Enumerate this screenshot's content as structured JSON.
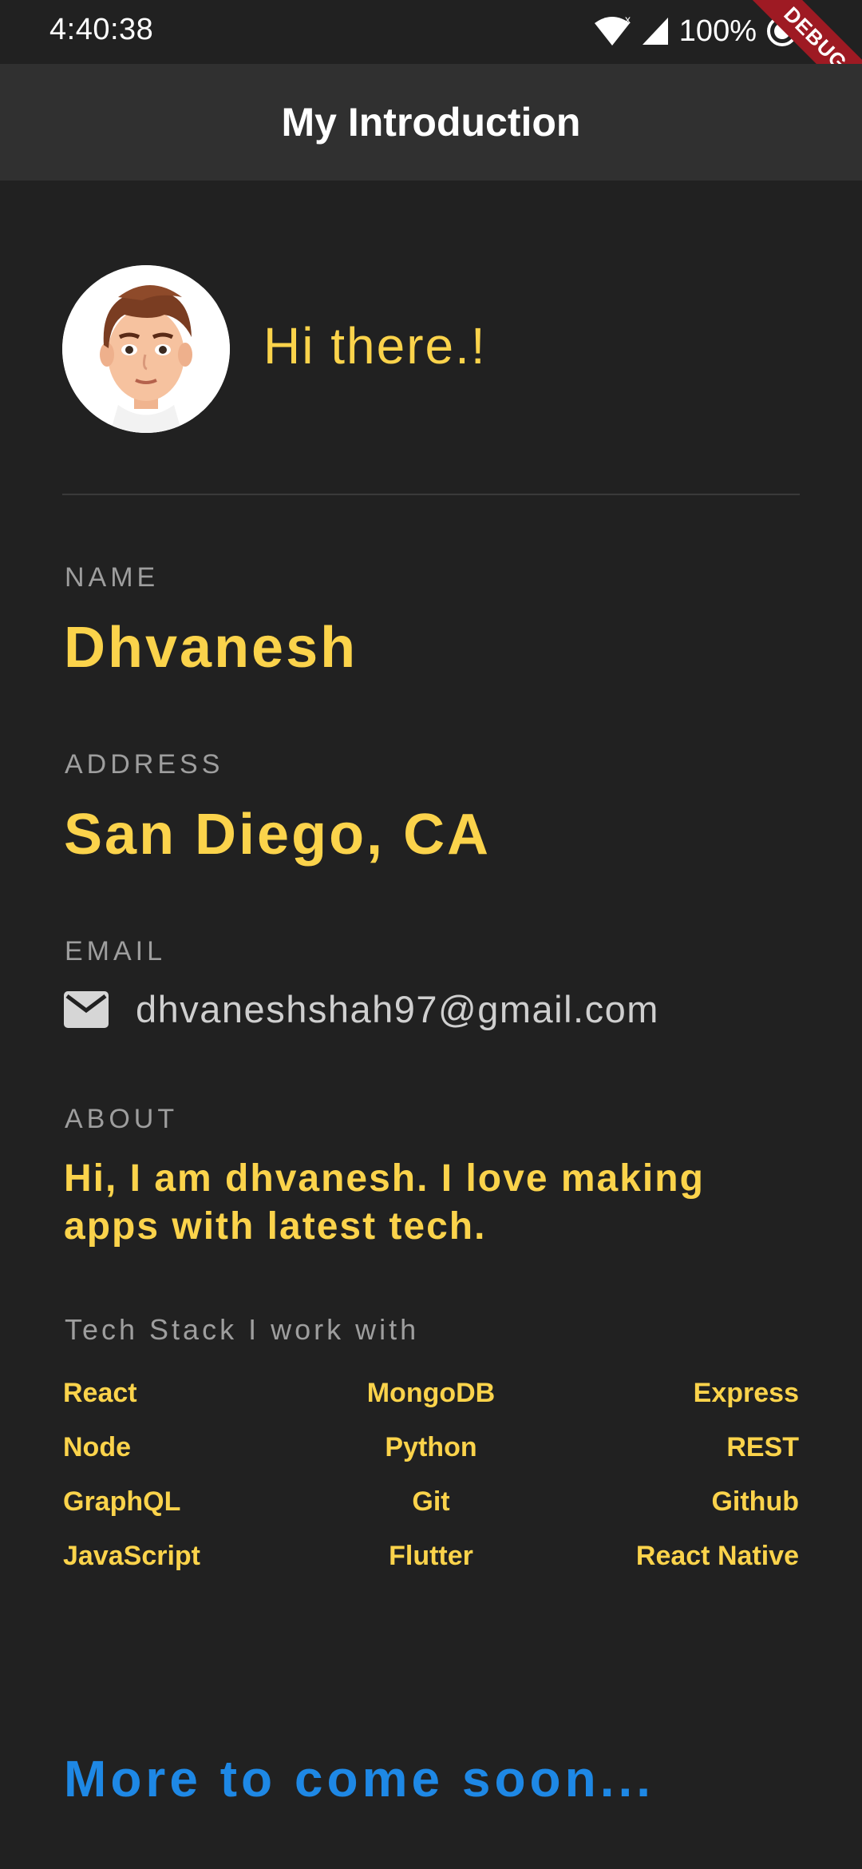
{
  "status": {
    "time": "4:40:38",
    "battery": "100%",
    "icons": [
      "wifi-icon",
      "signal-icon",
      "battery-icon"
    ]
  },
  "debug_banner": "DEBUG",
  "app_bar": {
    "title": "My Introduction"
  },
  "profile": {
    "avatar_icon": "cartoon-boy-avatar",
    "greeting": "Hi there.!"
  },
  "name": {
    "label": "NAME",
    "value": "Dhvanesh"
  },
  "address": {
    "label": "ADDRESS",
    "value": "San Diego, CA"
  },
  "email": {
    "label": "EMAIL",
    "icon": "mail-icon",
    "value": "dhvaneshshah97@gmail.com"
  },
  "about": {
    "label": "ABOUT",
    "text": "Hi, I am dhvanesh. I love making apps with latest tech."
  },
  "tech": {
    "title": "Tech Stack I work with",
    "rows": [
      [
        "React",
        "MongoDB",
        "Express"
      ],
      [
        "Node",
        "Python",
        "REST"
      ],
      [
        "GraphQL",
        "Git",
        "Github"
      ],
      [
        "JavaScript",
        "Flutter",
        "React Native"
      ]
    ]
  },
  "footer": {
    "text": "More to come soon..."
  },
  "colors": {
    "accent_yellow": "#fbd34b",
    "footer_blue": "#1e88e5",
    "background": "#212121",
    "app_bar": "#303030"
  }
}
